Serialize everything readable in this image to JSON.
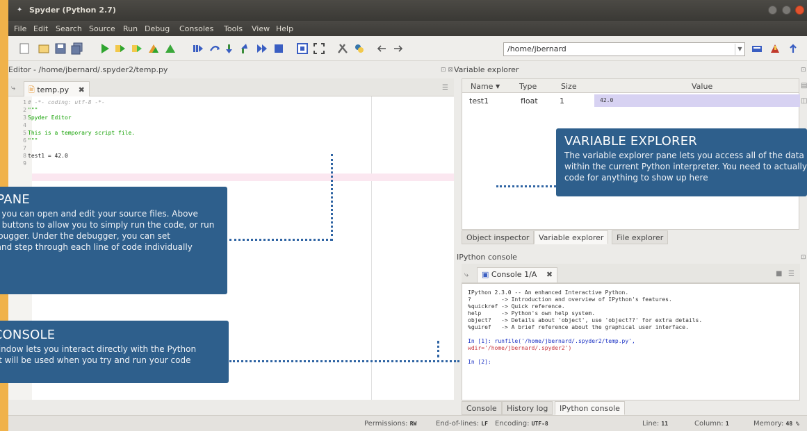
{
  "window": {
    "title": "Spyder (Python 2.7)"
  },
  "menu": [
    "File",
    "Edit",
    "Search",
    "Source",
    "Run",
    "Debug",
    "Consoles",
    "Tools",
    "View",
    "Help"
  ],
  "toolbar": {
    "path": "/home/jbernard"
  },
  "editor": {
    "title": "Editor - /home/jbernard/.spyder2/temp.py",
    "tab": "temp.py",
    "lines": [
      {
        "n": "1",
        "text": "# -*- coding: utf-8 -*-",
        "cls": "c-comment"
      },
      {
        "n": "2",
        "text": "\"\"\"",
        "cls": "c-string"
      },
      {
        "n": "3",
        "text": "Spyder Editor",
        "cls": "c-string"
      },
      {
        "n": "4",
        "text": "",
        "cls": "c-default"
      },
      {
        "n": "5",
        "text": "This is a temporary script file.",
        "cls": "c-string"
      },
      {
        "n": "6",
        "text": "\"\"\"",
        "cls": "c-string"
      },
      {
        "n": "7",
        "text": "",
        "cls": "c-default"
      },
      {
        "n": "8",
        "text": "test1 = 42.0",
        "cls": "c-default"
      },
      {
        "n": "9",
        "text": "",
        "cls": "c-default"
      }
    ]
  },
  "variable_explorer": {
    "title": "Variable explorer",
    "columns": [
      "Name",
      "Type",
      "Size",
      "Value"
    ],
    "rows": [
      {
        "name": "test1",
        "type": "float",
        "size": "1",
        "value": "42.0"
      }
    ]
  },
  "lower_tabs": [
    "Object inspector",
    "Variable explorer",
    "File explorer"
  ],
  "console": {
    "title": "IPython console",
    "tab": "Console 1/A",
    "lines": [
      {
        "text": "IPython 2.3.0 -- An enhanced Interactive Python.",
        "cls": ""
      },
      {
        "text": "?         -> Introduction and overview of IPython's features.",
        "cls": ""
      },
      {
        "text": "%quickref -> Quick reference.",
        "cls": ""
      },
      {
        "text": "help      -> Python's own help system.",
        "cls": ""
      },
      {
        "text": "object?   -> Details about 'object', use 'object??' for extra details.",
        "cls": ""
      },
      {
        "text": "%guiref   -> A brief reference about the graphical user interface.",
        "cls": ""
      },
      {
        "text": "",
        "cls": ""
      },
      {
        "text": "In [1]: runfile('/home/jbernard/.spyder2/temp.py',",
        "cls": "con-prompt"
      },
      {
        "text": "wdir='/home/jbernard/.spyder2')",
        "cls": "con-path"
      },
      {
        "text": "",
        "cls": ""
      },
      {
        "text": "In [2]:",
        "cls": "con-prompt"
      }
    ],
    "bottom_tabs": [
      "Console",
      "History log",
      "IPython console"
    ]
  },
  "status": {
    "permissions_label": "Permissions:",
    "permissions_value": "RW",
    "eol_label": "End-of-lines:",
    "eol_value": "LF",
    "encoding_label": "Encoding:",
    "encoding_value": "UTF-8",
    "line_label": "Line:",
    "line_value": "11",
    "column_label": "Column:",
    "column_value": "1",
    "memory_label": "Memory:",
    "memory_value": "48 %"
  },
  "callouts": {
    "variable_explorer": {
      "title": "VARIABLE EXPLORER",
      "text": "The variable explorer pane lets you access all of the data structures within the current Python interpreter. You need to actually run your code for anything to show up here"
    },
    "editor_pane": {
      "title": "EDITOR PANE",
      "text": "This is where you can open and edit your source files. Above this pane are buttons to allow you to simply run the code, or run it under a debugger. Under the debugger, you can set breakpoints and step through each line of code individually"
    },
    "python_console": {
      "title": "PYTHON CONSOLE",
      "text": "This console window lets you interact directly with the Python interpreter that will be used when you try and run your code"
    }
  },
  "colors": {
    "callout": "#2e5f8c",
    "dots": "#2f64a3",
    "frame": "#f0b24a"
  }
}
